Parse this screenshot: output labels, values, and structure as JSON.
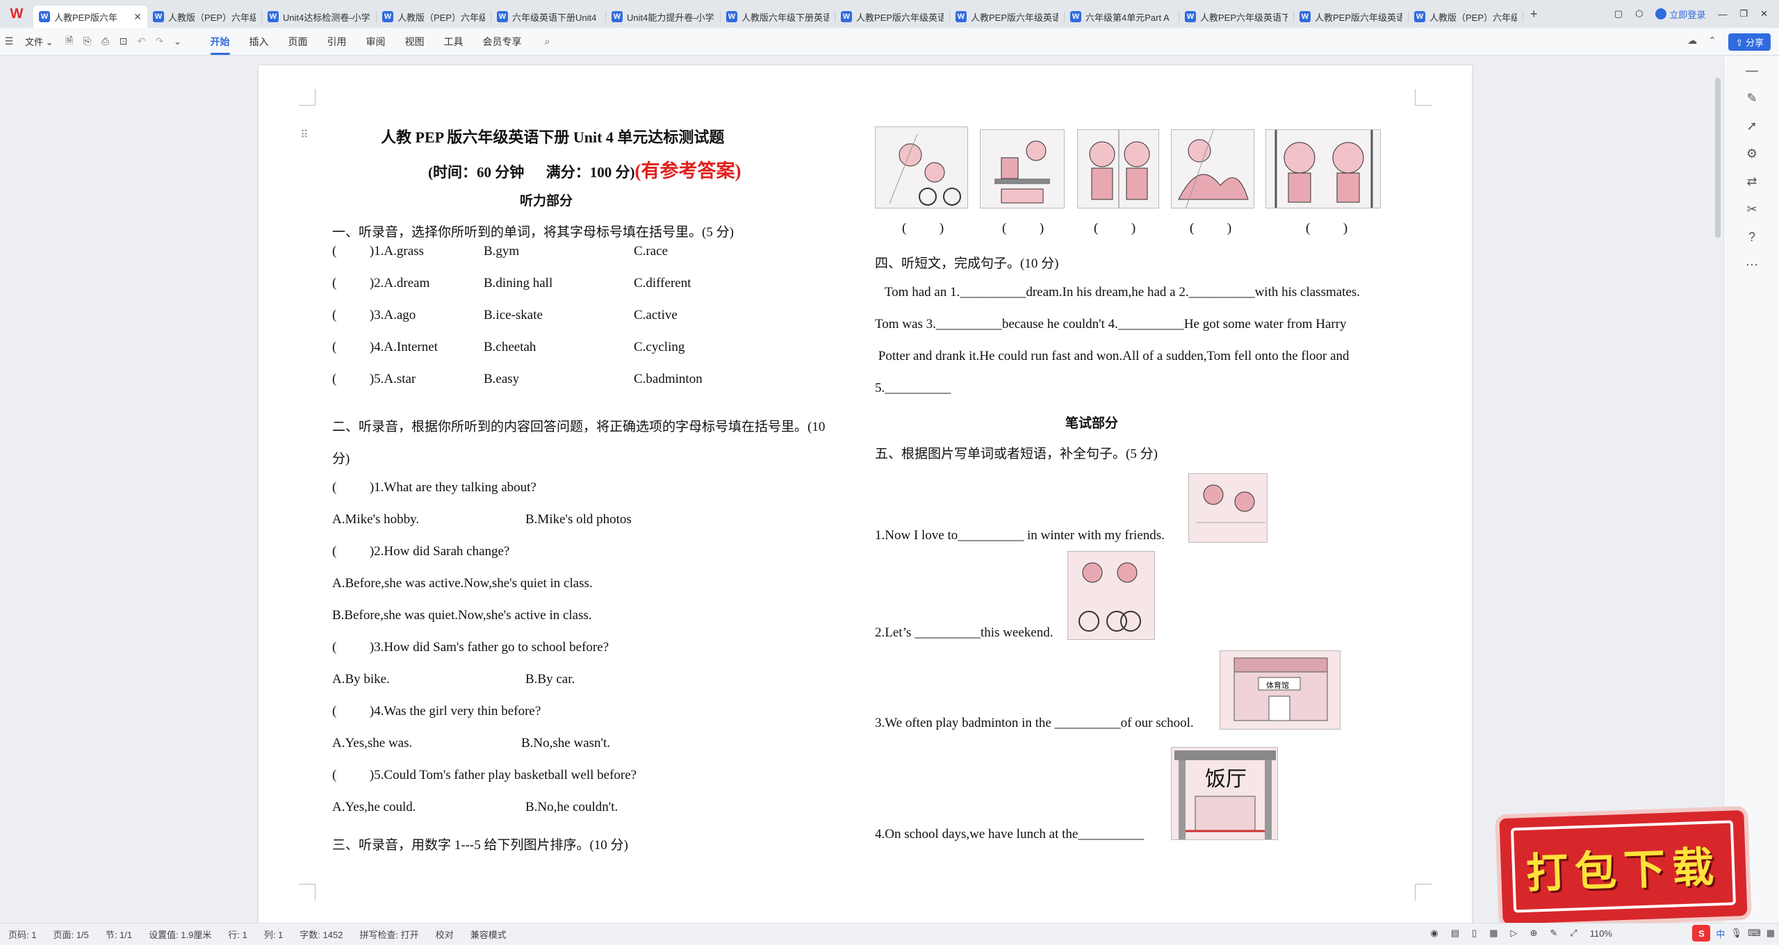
{
  "app": {
    "logo": "W"
  },
  "tabs": [
    {
      "label": "人教PEP版六年",
      "active": true
    },
    {
      "label": "人教版（PEP）六年级"
    },
    {
      "label": "Unit4达标检测卷-小学"
    },
    {
      "label": "人教版（PEP）六年级"
    },
    {
      "label": "六年级英语下册Unit4"
    },
    {
      "label": "Unit4能力提升卷-小学"
    },
    {
      "label": "人教版六年级下册英语"
    },
    {
      "label": "人教PEP版六年级英语"
    },
    {
      "label": "人教PEP版六年级英语"
    },
    {
      "label": "六年级第4单元Part A"
    },
    {
      "label": "人教PEP六年级英语下"
    },
    {
      "label": "人教PEP版六年级英语"
    },
    {
      "label": "人教版（PEP）六年级"
    }
  ],
  "titlebar": {
    "login": "立即登录",
    "add": "+"
  },
  "ribbon": {
    "file": "文件",
    "menus": [
      "开始",
      "插入",
      "页面",
      "引用",
      "审阅",
      "视图",
      "工具",
      "会员专享"
    ],
    "share": "分享"
  },
  "document": {
    "title": "人教 PEP 版六年级英语下册 Unit 4 单元达标测试题",
    "subtitle": "(时间：60 分钟      满分：100 分)",
    "subtitle_red": "(有参考答案)",
    "section_listen": "听力部分",
    "q1_head": "一、听录音，选择你所听到的单词，将其字母标号填在括号里。(5 分)",
    "q1_items": [
      {
        "n": "(          )1.A.grass",
        "b": "B.gym",
        "c": "C.race"
      },
      {
        "n": "(          )2.A.dream",
        "b": "B.dining hall",
        "c": "C.different"
      },
      {
        "n": "(          )3.A.ago",
        "b": "B.ice-skate",
        "c": "C.active"
      },
      {
        "n": "(          )4.A.Internet",
        "b": "B.cheetah",
        "c": "C.cycling"
      },
      {
        "n": "(          )5.A.star",
        "b": "B.easy",
        "c": "C.badminton"
      }
    ],
    "q2_head": "二、听录音，根据你所听到的内容回答问题，将正确选项的字母标号填在括号里。(10",
    "q2_head2": "分)",
    "q2_lines": [
      "(          )1.What are they talking about?",
      "A.Mike's hobby.",
      "B.Mike's old photos",
      "(          )2.How did Sarah change?",
      "A.Before,she was active.Now,she's quiet in class.",
      "B.Before,she was quiet.Now,she's active in class.",
      "(          )3.How did Sam's father go to school before?",
      "A.By bike.",
      "B.By car.",
      "(          )4.Was the girl very thin before?",
      "A.Yes,she was.",
      "B.No,she wasn't.",
      "(          )5.Could Tom's father play basketball well before?",
      "A.Yes,he could.",
      "B.No,he couldn't."
    ],
    "q3_head": "三、听录音，用数字 1---5 给下列图片排序。(10 分)",
    "q3_brackets": [
      "(          )",
      "(          )",
      "(          )",
      "(          )",
      "(          )"
    ],
    "q4_head": "四、听短文，完成句子。(10 分)",
    "q4_lines": [
      "   Tom had an 1.__________dream.In his dream,he had a 2.__________with his classmates.",
      "Tom was 3.__________because he couldn't 4.__________He got some water from Harry",
      " Potter and drank it.He could run fast and won.All of a sudden,Tom fell onto the floor and",
      "5.__________"
    ],
    "section_write": "笔试部分",
    "q5_head": "五、根据图片写单词或者短语，补全句子。(5 分)",
    "q5_items": [
      "1.Now I love to__________ in winter with my friends.",
      "2.Let’s __________this weekend.",
      "3.We often play badminton in the __________of our school.",
      "4.On school days,we have lunch at the__________"
    ],
    "pic_labels": {
      "gym": "体育馆",
      "dining": "饭厅"
    }
  },
  "statusbar": {
    "items": [
      "页码: 1",
      "页面: 1/5",
      "节: 1/1",
      "设置值: 1.9厘米",
      "行: 1",
      "列: 1",
      "字数: 1452",
      "拼写检查: 打开",
      "校对",
      "兼容模式"
    ],
    "zoom": "110%",
    "ime": [
      "S",
      "中",
      "·",
      "•"
    ]
  },
  "badge": {
    "text": "打包下载"
  },
  "colors": {
    "accent": "#2f6bde",
    "red": "#e0201c",
    "badge": "#d8272b"
  }
}
